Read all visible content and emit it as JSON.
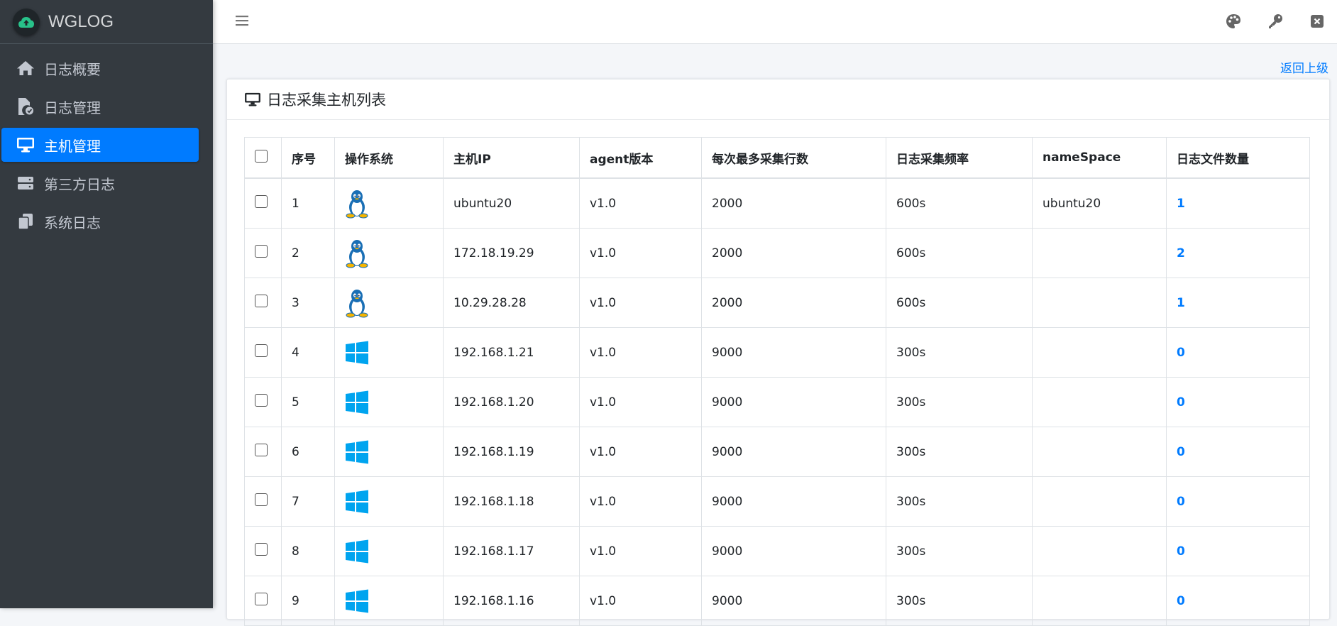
{
  "app": {
    "brand": "WGLOG"
  },
  "sidebar": {
    "items": [
      {
        "label": "日志概要",
        "icon": "home-icon",
        "active": false
      },
      {
        "label": "日志管理",
        "icon": "file-check-icon",
        "active": false
      },
      {
        "label": "主机管理",
        "icon": "desktop-icon",
        "active": true
      },
      {
        "label": "第三方日志",
        "icon": "server-icon",
        "active": false
      },
      {
        "label": "系统日志",
        "icon": "copy-icon",
        "active": false
      }
    ]
  },
  "topbar": {
    "icons": [
      "menu-icon",
      "palette-icon",
      "key-icon",
      "close-square-icon"
    ]
  },
  "main": {
    "back_link": "返回上级",
    "card_title": "日志采集主机列表",
    "table": {
      "headers": [
        "序号",
        "操作系统",
        "主机IP",
        "agent版本",
        "每次最多采集行数",
        "日志采集频率",
        "nameSpace",
        "日志文件数量"
      ],
      "rows": [
        {
          "index": "1",
          "os": "linux",
          "ip": "ubuntu20",
          "version": "v1.0",
          "max_lines": "2000",
          "frequency": "600s",
          "namespace": "ubuntu20",
          "file_count": "1"
        },
        {
          "index": "2",
          "os": "linux",
          "ip": "172.18.19.29",
          "version": "v1.0",
          "max_lines": "2000",
          "frequency": "600s",
          "namespace": "",
          "file_count": "2"
        },
        {
          "index": "3",
          "os": "linux",
          "ip": "10.29.28.28",
          "version": "v1.0",
          "max_lines": "2000",
          "frequency": "600s",
          "namespace": "",
          "file_count": "1"
        },
        {
          "index": "4",
          "os": "windows",
          "ip": "192.168.1.21",
          "version": "v1.0",
          "max_lines": "9000",
          "frequency": "300s",
          "namespace": "",
          "file_count": "0"
        },
        {
          "index": "5",
          "os": "windows",
          "ip": "192.168.1.20",
          "version": "v1.0",
          "max_lines": "9000",
          "frequency": "300s",
          "namespace": "",
          "file_count": "0"
        },
        {
          "index": "6",
          "os": "windows",
          "ip": "192.168.1.19",
          "version": "v1.0",
          "max_lines": "9000",
          "frequency": "300s",
          "namespace": "",
          "file_count": "0"
        },
        {
          "index": "7",
          "os": "windows",
          "ip": "192.168.1.18",
          "version": "v1.0",
          "max_lines": "9000",
          "frequency": "300s",
          "namespace": "",
          "file_count": "0"
        },
        {
          "index": "8",
          "os": "windows",
          "ip": "192.168.1.17",
          "version": "v1.0",
          "max_lines": "9000",
          "frequency": "300s",
          "namespace": "",
          "file_count": "0"
        },
        {
          "index": "9",
          "os": "windows",
          "ip": "192.168.1.16",
          "version": "v1.0",
          "max_lines": "9000",
          "frequency": "300s",
          "namespace": "",
          "file_count": "0"
        }
      ]
    }
  },
  "colors": {
    "sidebar_bg": "#343a40",
    "accent": "#007bff",
    "windows_blue": "#00a4ef"
  }
}
